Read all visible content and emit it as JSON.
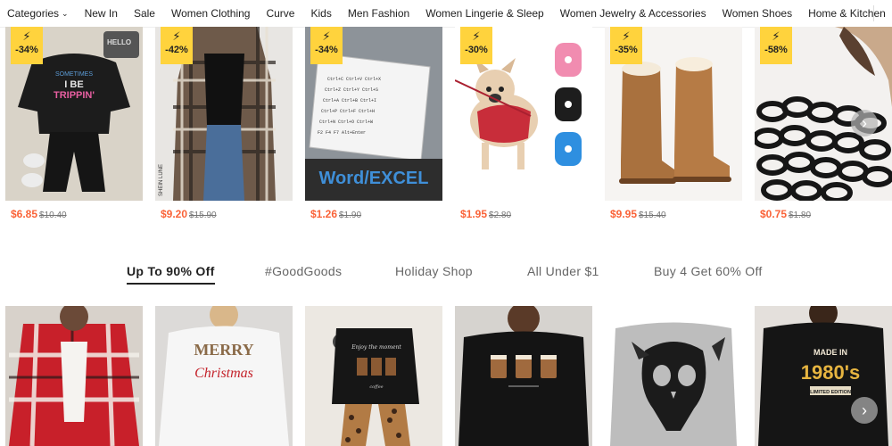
{
  "nav": {
    "items": [
      {
        "label": "Categories",
        "has_chevron": true
      },
      {
        "label": "New In"
      },
      {
        "label": "Sale"
      },
      {
        "label": "Women Clothing"
      },
      {
        "label": "Curve"
      },
      {
        "label": "Kids"
      },
      {
        "label": "Men Fashion"
      },
      {
        "label": "Women Lingerie & Sleep"
      },
      {
        "label": "Women Jewelry & Accessories"
      },
      {
        "label": "Women Shoes"
      },
      {
        "label": "Home & Kitchen"
      }
    ],
    "chevron_icon": "chevron-down-icon"
  },
  "flash_sale": {
    "badge_icon": "lightning-bolt-icon",
    "badge_color": "#ffd33d",
    "products": [
      {
        "discount": "-34%",
        "price": "$6.85",
        "original_price": "$10.40",
        "image_text": [
          "SOMETIMES",
          "I BE",
          "TRIPPIN'"
        ]
      },
      {
        "discount": "-42%",
        "price": "$9.20",
        "original_price": "$15.90",
        "image_text": [
          "SHEIN LUNE"
        ]
      },
      {
        "discount": "-34%",
        "price": "$1.26",
        "original_price": "$1.90",
        "image_text": [
          "Word/EXCEL"
        ]
      },
      {
        "discount": "-30%",
        "price": "$1.95",
        "original_price": "$2.80",
        "image_text": []
      },
      {
        "discount": "-35%",
        "price": "$9.95",
        "original_price": "$15.40",
        "image_text": []
      },
      {
        "discount": "-58%",
        "price": "$0.75",
        "original_price": "$1.80",
        "image_text": []
      }
    ]
  },
  "tabs": [
    {
      "label": "Up To 90% Off",
      "active": true
    },
    {
      "label": "#GoodGoods",
      "active": false
    },
    {
      "label": "Holiday Shop",
      "active": false
    },
    {
      "label": "All Under $1",
      "active": false
    },
    {
      "label": "Buy 4 Get 60% Off",
      "active": false
    }
  ],
  "recommended": {
    "products": [
      {
        "image_text": []
      },
      {
        "image_text": [
          "MERRY",
          "Christmas"
        ]
      },
      {
        "image_text": [
          "Enjoy the moment",
          "coffee"
        ]
      },
      {
        "image_text": []
      },
      {
        "image_text": []
      },
      {
        "image_text": [
          "MADE IN",
          "1980's",
          "LIMITED EDITION"
        ]
      }
    ]
  },
  "carousel": {
    "next_icon": "chevron-right-icon"
  },
  "colors": {
    "price": "#fa6338",
    "original_price": "#767676",
    "accent": "#222222"
  }
}
